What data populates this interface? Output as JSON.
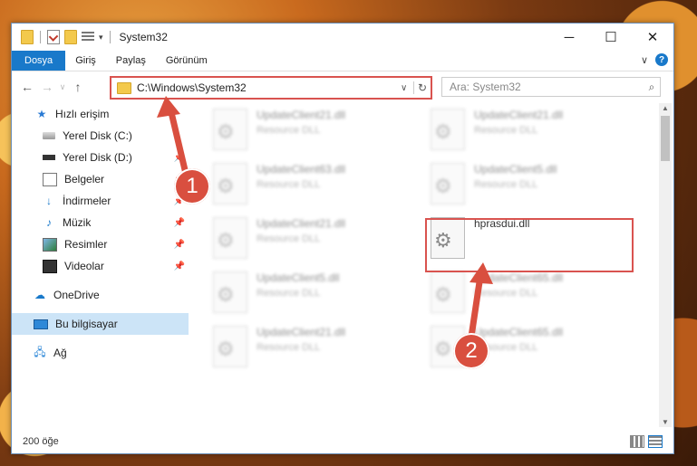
{
  "window": {
    "title": "System32",
    "controls": [
      "─",
      "☐",
      "✕"
    ]
  },
  "ribbon": {
    "tabs": [
      "Dosya",
      "Giriş",
      "Paylaş",
      "Görünüm"
    ],
    "help": "?"
  },
  "address": {
    "path": "C:\\Windows\\System32",
    "search_placeholder": "Ara: System32"
  },
  "sidebar": {
    "quick_access": "Hızlı erişim",
    "items": [
      "Yerel Disk (C:)",
      "Yerel Disk (D:)",
      "Belgeler",
      "İndirmeler",
      "Müzik",
      "Resimler",
      "Videolar"
    ],
    "onedrive": "OneDrive",
    "this_pc": "Bu bilgisayar",
    "network": "Ağ"
  },
  "files": [
    {
      "name": "UpdateClient21.dll",
      "desc": "Resource DLL"
    },
    {
      "name": "UpdateClient21.dll",
      "desc": "Resource DLL"
    },
    {
      "name": "UpdateClient63.dll",
      "desc": "Resource DLL"
    },
    {
      "name": "UpdateClient5.dll",
      "desc": "Resource DLL"
    },
    {
      "name": "UpdateClient21.dll",
      "desc": "Resource DLL"
    },
    {
      "name": "hprasdui.dll",
      "desc": ""
    },
    {
      "name": "UpdateClient5.dll",
      "desc": "Resource DLL"
    },
    {
      "name": "UpdateClient65.dll",
      "desc": "Resource DLL"
    },
    {
      "name": "UpdateClient21.dll",
      "desc": "Resource DLL"
    },
    {
      "name": "UpdateClient65.dll",
      "desc": "Resource DLL"
    }
  ],
  "status": {
    "count": "200 öğe"
  },
  "annotations": {
    "step1": "1",
    "step2": "2"
  }
}
